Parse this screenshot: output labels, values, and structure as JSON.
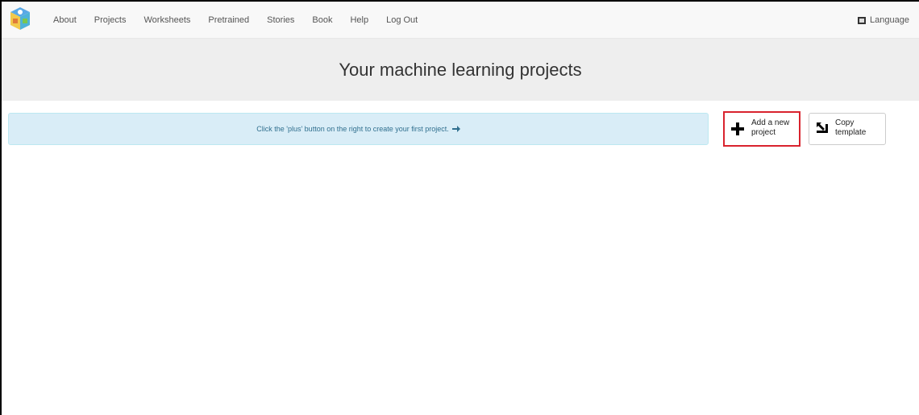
{
  "nav": {
    "items": [
      "About",
      "Projects",
      "Worksheets",
      "Pretrained",
      "Stories",
      "Book",
      "Help",
      "Log Out"
    ],
    "language": "Language"
  },
  "hero": {
    "title": "Your machine learning projects"
  },
  "alert": {
    "text": "Click the 'plus' button on the right to create your first project."
  },
  "buttons": {
    "add": {
      "label": "Add a new project"
    },
    "copy": {
      "label": "Copy template"
    }
  },
  "colors": {
    "highlight_border": "#d9232e",
    "alert_background": "#d9edf7",
    "alert_text": "#31708f",
    "hero_background": "#eeeeee"
  },
  "icons": {
    "logo": "mlforkids-cube-logo",
    "language": "flag-icon",
    "alert": "arrow-right-icon",
    "add": "plus-icon",
    "copy": "copy-template-icon"
  }
}
